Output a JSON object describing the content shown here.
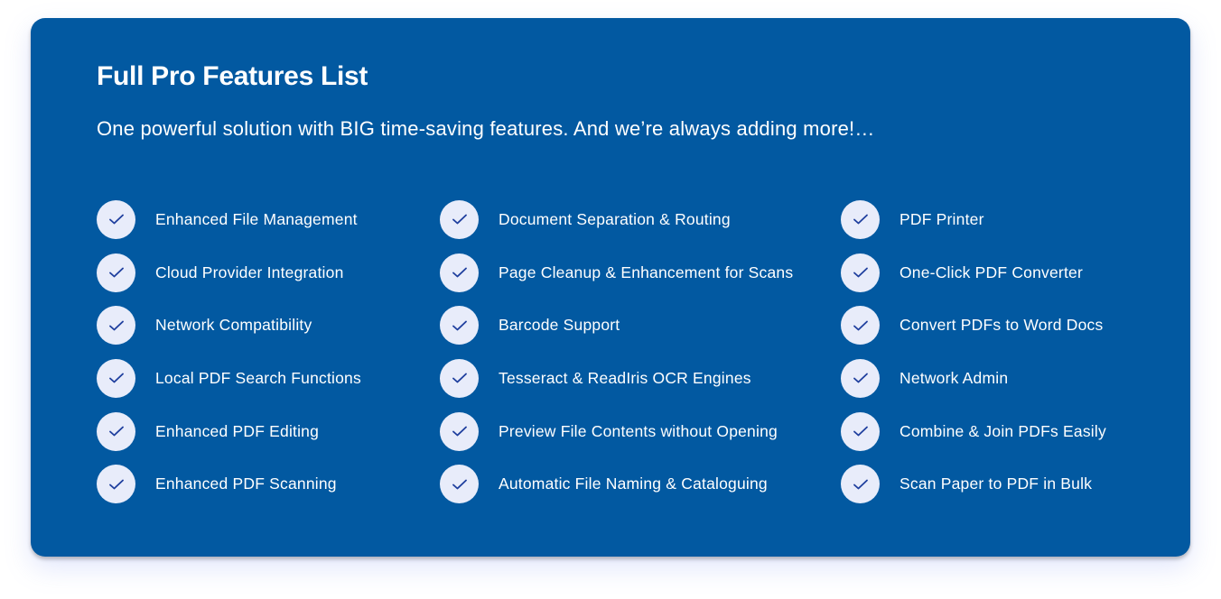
{
  "title": "Full Pro Features List",
  "subtitle": "One powerful solution with BIG time-saving features. And we’re always adding more!…",
  "colors": {
    "card": "#0259a1",
    "check_bg": "#e8ecfa",
    "check_mark": "#1f3f9e"
  },
  "check_icon": "check-icon",
  "columns": [
    [
      "Enhanced File Management",
      "Cloud Provider Integration",
      "Network Compatibility",
      "Local PDF Search Functions",
      "Enhanced PDF Editing",
      "Enhanced PDF Scanning"
    ],
    [
      "Document Separation & Routing",
      "Page Cleanup & Enhancement for Scans",
      "Barcode Support",
      "Tesseract & ReadIris OCR Engines",
      "Preview File Contents without Opening",
      "Automatic File Naming & Cataloguing"
    ],
    [
      "PDF Printer",
      "One-Click PDF Converter",
      "Convert PDFs to Word Docs",
      "Network Admin",
      "Combine & Join PDFs Easily",
      "Scan Paper to PDF in Bulk"
    ]
  ]
}
